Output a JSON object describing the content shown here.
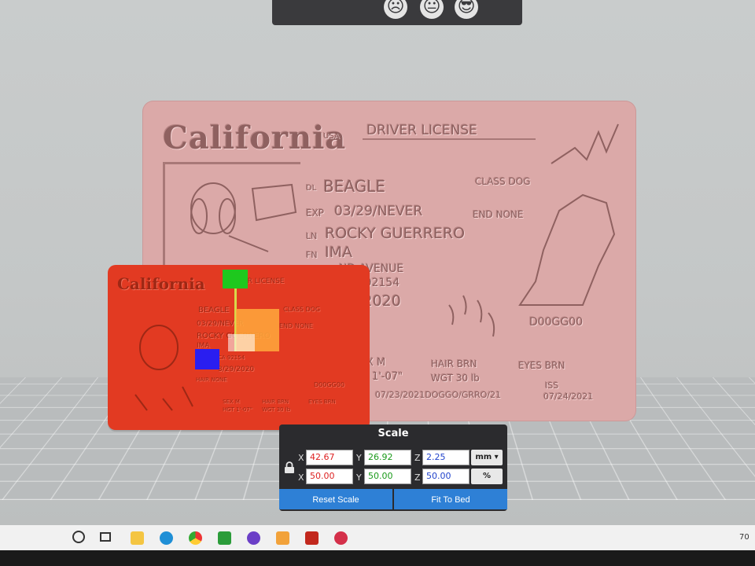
{
  "card_big": {
    "state_name": "California",
    "state_suffix": "USA",
    "doc_type": "DRIVER LICENSE",
    "dl_prefix": "DL",
    "dl_value": "BEAGLE",
    "class_text": "CLASS DOG",
    "exp_prefix": "EXP",
    "exp_value": "03/29/NEVER",
    "end_text": "END NONE",
    "ln_prefix": "LN",
    "ln_value": "ROCKY GUERRERO",
    "fn_prefix": "FN",
    "fn_value": "IMA",
    "address1": "ND AVENUE",
    "address2": ", CA 92154",
    "dob_partial": "9/2020",
    "id_code": "D00GG00",
    "sex": "X  M",
    "height": "T  1'-07\"",
    "hair": "HAIR  BRN",
    "weight": "WGT  30 lb",
    "eyes": "EYES BRN",
    "issue_line": "07/23/2021DOGGO/GRRO/21",
    "iss_label": "ISS",
    "iss_value": "07/24/2021"
  },
  "card_small": {
    "state_name": "California",
    "doc_type": "DRIVER LICENSE",
    "dl_value": "BEAGLE",
    "class_text": "CLASS DOG",
    "exp_value": "03/29/NEVER",
    "end_text": "END NONE",
    "ln_value": "ROCKY GUERRERO",
    "fn_value": "IMA",
    "address_line": "CA 92154",
    "dob": "3/29/2020",
    "hair_line": "HAIR NONE",
    "id_code": "D00GG00",
    "sex": "SEX M",
    "hair": "HAIR BRN",
    "eyes": "EYES BRN",
    "height": "HGT 1'-07\"",
    "weight": "WGT 30 lb"
  },
  "scale_panel": {
    "title": "Scale",
    "row_mm": {
      "x": "42.67",
      "y": "26.92",
      "z": "2.25",
      "unit": "mm"
    },
    "row_pct": {
      "x": "50.00",
      "y": "50.00",
      "z": "50.00",
      "unit": "%"
    },
    "axis_x": "X",
    "axis_y": "Y",
    "axis_z": "Z",
    "reset_label": "Reset Scale",
    "fit_label": "Fit To Bed"
  },
  "tray": {
    "partial_text": "70"
  }
}
